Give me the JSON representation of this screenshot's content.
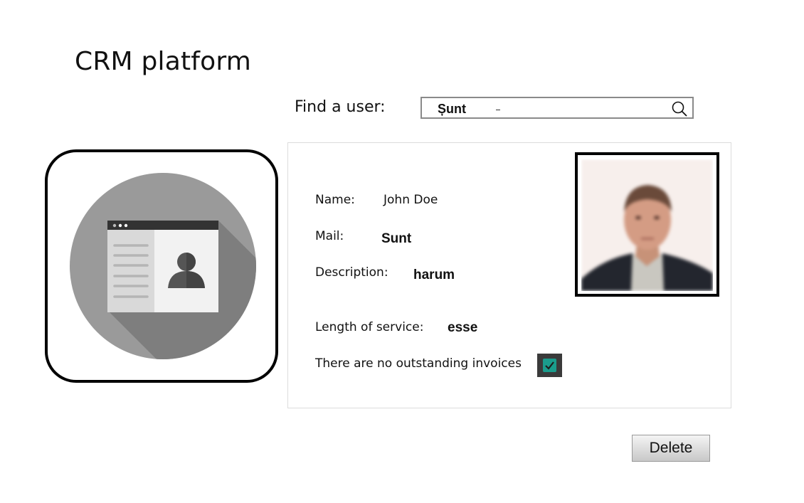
{
  "app": {
    "title": "CRM platform"
  },
  "search": {
    "label": "Find a user:",
    "value": "Șunt"
  },
  "details": {
    "name_label": "Name:",
    "name_value": "John Doe",
    "mail_label": "Mail:",
    "mail_value": "Sunt",
    "description_label": "Description:",
    "description_value": "harum",
    "service_label": "Length of service:",
    "service_value": "esse",
    "invoices_label": "There are no outstanding invoices",
    "invoices_checked": true
  },
  "actions": {
    "delete_label": "Delete"
  },
  "icons": {
    "app": "contact-card-icon",
    "search": "search-icon",
    "check": "check-icon"
  },
  "colors": {
    "checkbox_fill": "#1a9c8c",
    "icon_circle": "#9a9a9a"
  }
}
